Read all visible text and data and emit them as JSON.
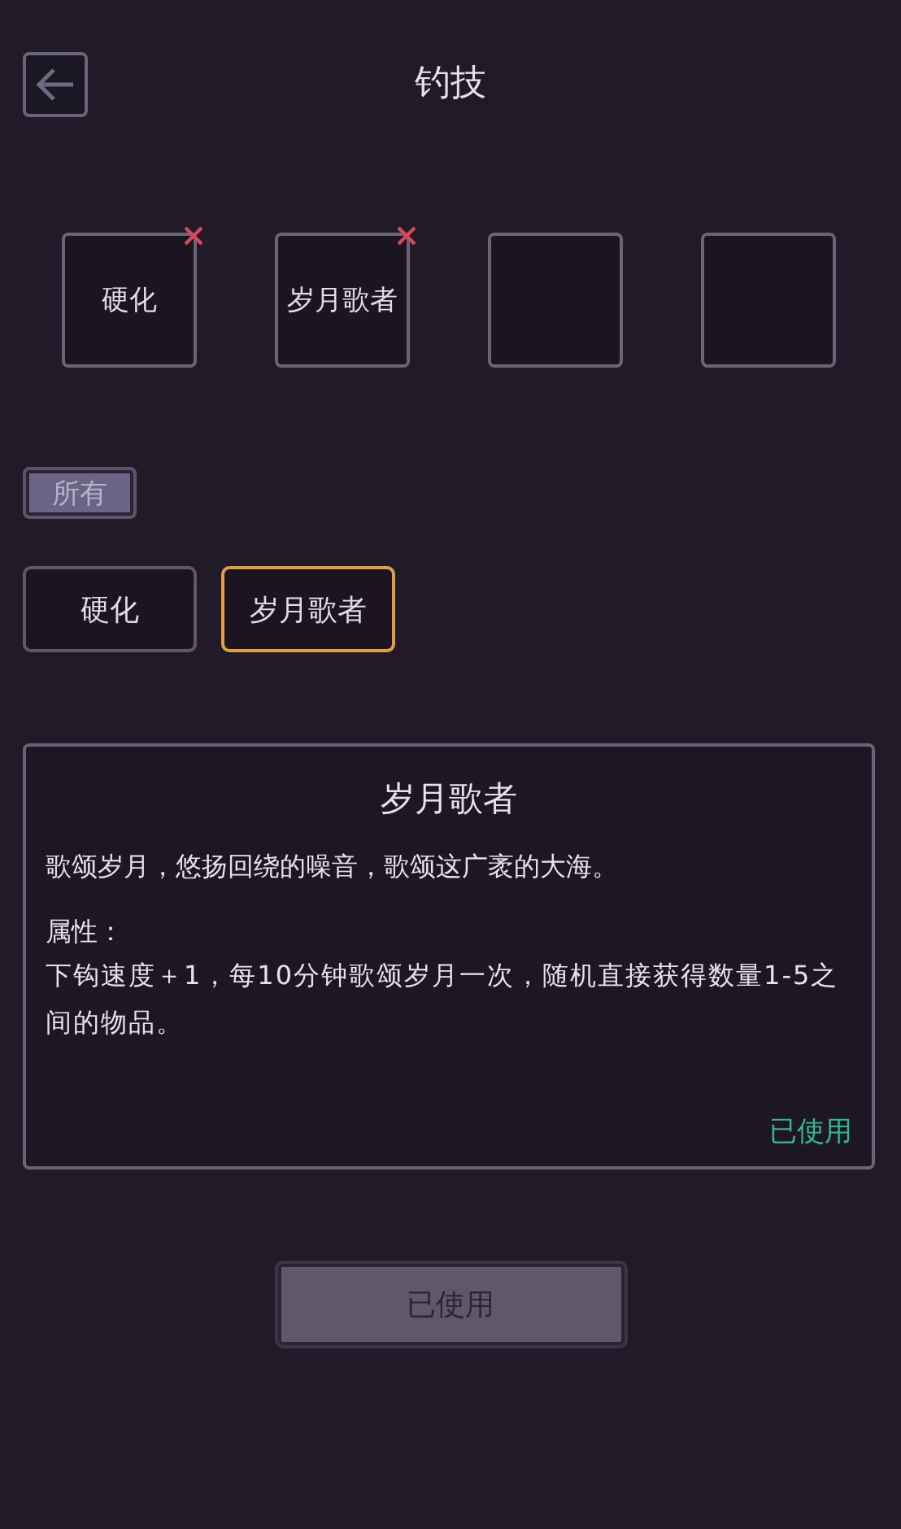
{
  "header": {
    "title": "钓技"
  },
  "slots": [
    {
      "kind": "skill",
      "label": "硬化",
      "removable": true
    },
    {
      "kind": "skill",
      "label": "岁月歌者",
      "removable": true
    },
    {
      "kind": "empty"
    },
    {
      "kind": "empty"
    }
  ],
  "filters": [
    {
      "label": "所有",
      "selected": true
    }
  ],
  "skills": [
    {
      "label": "硬化",
      "selected": false
    },
    {
      "label": "岁月歌者",
      "selected": true
    }
  ],
  "detail": {
    "title": "岁月歌者",
    "description": "歌颂岁月，悠扬回绕的噪音，歌颂这广袤的大海。",
    "attributes_label": "属性：",
    "attributes": "下钩速度＋1，每10分钟歌颂岁月一次，随机直接获得数量1-5之间的物品。",
    "status": "已使用"
  },
  "action_button": {
    "label": "已使用",
    "disabled": true
  }
}
